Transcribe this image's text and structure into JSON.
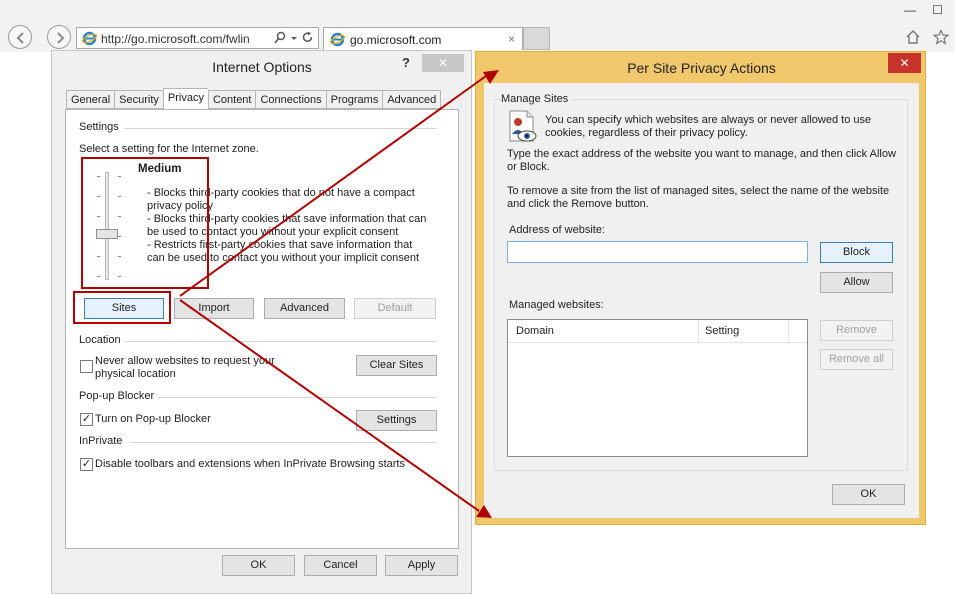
{
  "browser": {
    "url": "http://go.microsoft.com/fwlin",
    "tab_title": "go.microsoft.com",
    "tab_close": "×",
    "win_minimize": "—",
    "win_maximize": "☐"
  },
  "internet_options": {
    "title": "Internet Options",
    "help": "?",
    "close": "✕",
    "tabs": [
      "General",
      "Security",
      "Privacy",
      "Content",
      "Connections",
      "Programs",
      "Advanced"
    ],
    "active_tab": "Privacy",
    "settings": {
      "label": "Settings",
      "hint": "Select a setting for the Internet zone.",
      "level": "Medium",
      "description": [
        "- Blocks third-party cookies that do not have a compact",
        "privacy policy",
        "- Blocks third-party cookies that save information that can",
        "be used to contact you without your explicit consent",
        "- Restricts first-party cookies that save information that",
        "can be used to contact you without your implicit consent"
      ],
      "buttons": {
        "sites": "Sites",
        "import": "Import",
        "advanced": "Advanced",
        "default": "Default"
      }
    },
    "location": {
      "label": "Location",
      "checkbox_line1": "Never allow websites to request your",
      "checkbox_line2": "physical location",
      "checked": false,
      "clear_sites": "Clear Sites"
    },
    "popup_blocker": {
      "label": "Pop-up Blocker",
      "checkbox": "Turn on Pop-up Blocker",
      "checked": true,
      "settings": "Settings"
    },
    "inprivate": {
      "label": "InPrivate",
      "checkbox": "Disable toolbars and extensions when InPrivate Browsing starts",
      "checked": true
    },
    "footer": {
      "ok": "OK",
      "cancel": "Cancel",
      "apply": "Apply"
    }
  },
  "per_site": {
    "title": "Per Site Privacy Actions",
    "close": "✕",
    "group_label": "Manage Sites",
    "intro_line1": "You can specify which websites are always or never allowed to use",
    "intro_line2": "cookies, regardless of their privacy policy.",
    "instr1_line1": "Type the exact address of the website you want to manage, and then click Allow",
    "instr1_line2": "or Block.",
    "instr2_line1": "To remove a site from the list of managed sites, select the name of the website",
    "instr2_line2": "and click the Remove button.",
    "address_label": "Address of website:",
    "address_value": "",
    "block": "Block",
    "allow": "Allow",
    "managed_label": "Managed websites:",
    "columns": [
      "Domain",
      "Setting"
    ],
    "rows": [],
    "remove": "Remove",
    "remove_all": "Remove all",
    "ok": "OK"
  },
  "colors": {
    "highlight_red": "#b00000",
    "dialog_frame": "#f1c76b",
    "close_red": "#c7332b"
  }
}
